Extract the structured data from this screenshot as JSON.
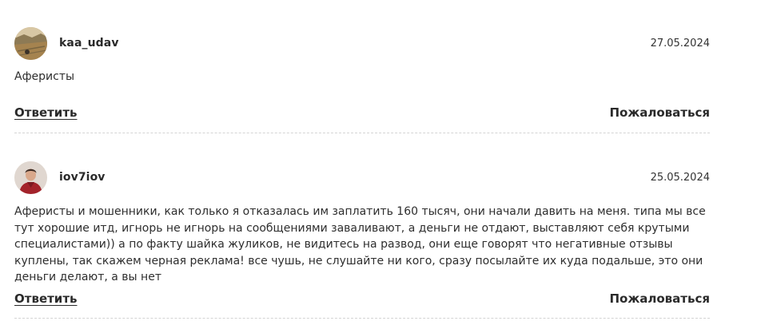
{
  "reviews": [
    {
      "username": "kaa_udav",
      "date": "27.05.2024",
      "text": "Аферисты",
      "reply_label": "Ответить",
      "complain_label": "Пожаловаться"
    },
    {
      "username": "iov7iov",
      "date": "25.05.2024",
      "text": "Аферисты и мошенники, как только я отказалась им заплатить 160 тысяч, они начали давить на меня. типа мы все тут хорошие итд, игнорь не игнорь на сообщениями заваливают, а деньги не отдают, выставляют себя крутыми специалистами)) а по факту шайка жуликов, не видитесь на развод, они еще говорят что негативные отзывы куплены, так скажем черная реклама! все чушь, не слушайте ни кого, сразу посылайте их куда подальше, это они деньги делают, а вы нет",
      "reply_label": "Ответить",
      "complain_label": "Пожаловаться"
    }
  ]
}
